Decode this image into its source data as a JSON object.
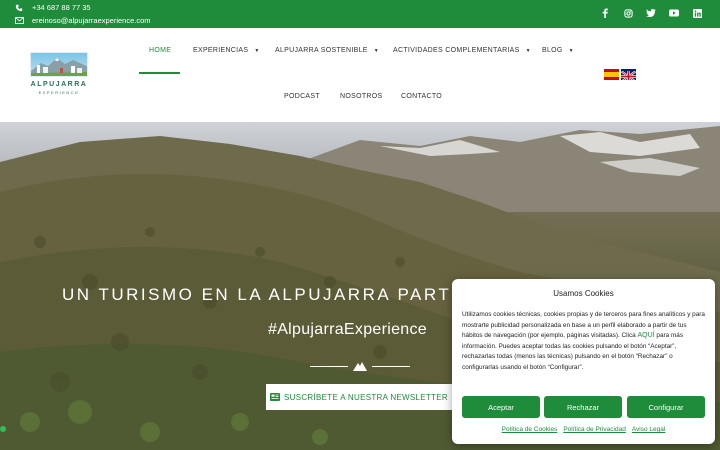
{
  "topbar": {
    "phone": "+34 687 88 77 35",
    "email": "ereinoso@alpujarraexperience.com",
    "social": [
      "facebook-icon",
      "instagram-icon",
      "twitter-icon",
      "youtube-icon",
      "linkedin-icon"
    ],
    "bg_color": "#1e8c3a"
  },
  "logo": {
    "name": "ALPUJARRA",
    "sub": "EXPERIENCE"
  },
  "nav": {
    "items": [
      {
        "label": "HOME",
        "active": true
      },
      {
        "label": "EXPERIENCIAS",
        "dropdown": true
      },
      {
        "label": "ALPUJARRA SOSTENIBLE",
        "dropdown": true
      },
      {
        "label": "ACTIVIDADES COMPLEMENTARIAS",
        "dropdown": true
      },
      {
        "label": "BLOG",
        "dropdown": true
      },
      {
        "label": "PODCAST"
      },
      {
        "label": "NOSOTROS"
      },
      {
        "label": "CONTACTO"
      }
    ],
    "languages": [
      "es",
      "en"
    ]
  },
  "hero": {
    "title": "UN TURISMO EN LA ALPUJARRA PARTICUL",
    "tag": "#AlpujarraExperience",
    "newsletter": "SUSCRÍBETE A NUESTRA NEWSLETTER"
  },
  "cookie": {
    "title": "Usamos Cookies",
    "text_before": "Utilizamos cookies técnicas, cookies propias y de terceros para fines analíticos y para mostrarte publicidad personalizada en base a un perfil elaborado a partir de tus hábitos de navegación (por ejemplo, páginas visitadas). Clica ",
    "link": "AQUÍ",
    "text_after": " para más información. Puedes aceptar todas las cookies pulsando el botón “Aceptar”, rechazarlas todas (menos las técnicas) pulsando en el botón “Rechazar” o configurarlas usando el botón “Configurar”.",
    "accept": "Aceptar",
    "reject": "Rechazar",
    "configure": "Configurar",
    "footer": [
      "Política de Cookies",
      "Política de Privacidad",
      "Aviso Legal"
    ]
  },
  "colors": {
    "accent": "#1e8c3a"
  }
}
